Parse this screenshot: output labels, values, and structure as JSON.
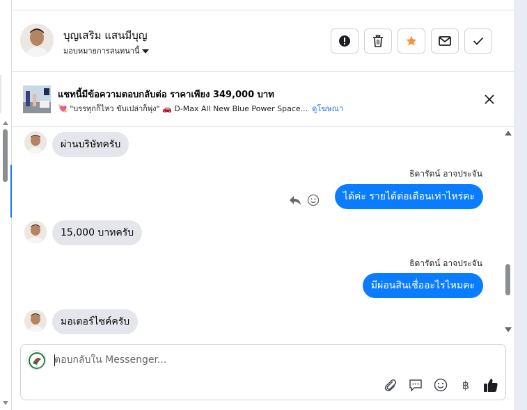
{
  "header": {
    "contact_name": "บุญเสริม แสนมีบุญ",
    "assign_label": "มอบหมายการสนทนานี้",
    "actions": [
      {
        "name": "report-button",
        "icon": "alert-circle-icon"
      },
      {
        "name": "delete-button",
        "icon": "trash-icon"
      },
      {
        "name": "star-button",
        "icon": "star-icon"
      },
      {
        "name": "mark-unread-button",
        "icon": "envelope-icon"
      },
      {
        "name": "mark-done-button",
        "icon": "check-icon"
      }
    ],
    "star_color": "#f7923b"
  },
  "ad": {
    "title": "แชทนี้มีข้อความตอบกลับต่อ ราคาเพียง 349,000 บาท",
    "subtitle": "💘 \"บรรทุกก็ไหว ขับเปล่าก็พุ่ง\" 🚗 D-Max All New Blue Power Space...",
    "link": "ดูโฆษณา"
  },
  "messages": [
    {
      "direction": "in",
      "text": "ผ่านบริษัทครับ"
    },
    {
      "direction": "out",
      "sender": "ธิดารัตน์ อาจประจัน",
      "text": "ได้ค่ะ รายได้ต่อเดือนเท่าไหร่คะ"
    },
    {
      "direction": "in",
      "text": "15,000 บาทครับ"
    },
    {
      "direction": "out",
      "sender": "ธิดารัตน์ อาจประจัน",
      "text": "มีผ่อนสินเชื่ออะไรไหมคะ"
    },
    {
      "direction": "in",
      "text": "มอเตอร์ไซค์ครับ"
    }
  ],
  "composer": {
    "placeholder": "ตอบกลับใน Messenger...",
    "value": "",
    "tools": [
      "paperclip-icon",
      "saved-reply-icon",
      "emoji-icon",
      "baht-icon",
      "thumbs-up-icon"
    ],
    "baht_symbol": "฿"
  },
  "colors": {
    "outgoing_bubble": "#0a7cff",
    "incoming_bubble": "#e4e6eb",
    "link": "#1877f2"
  }
}
